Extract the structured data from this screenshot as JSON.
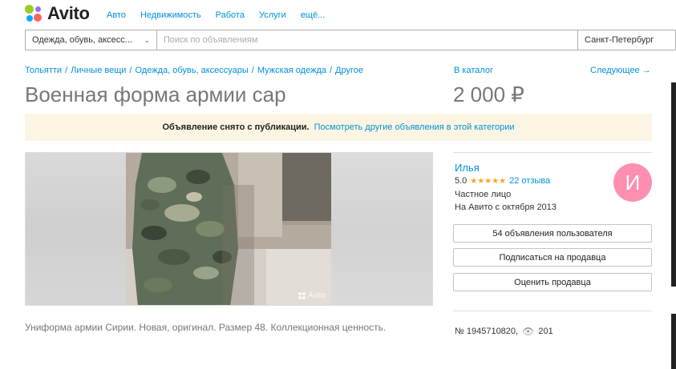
{
  "brand": {
    "name": "Avito"
  },
  "topnav": [
    "Авто",
    "Недвижимость",
    "Работа",
    "Услуги",
    "ещё..."
  ],
  "search": {
    "category": "Одежда, обувь, аксесс...",
    "placeholder": "Поиск по объявлениям",
    "city": "Санкт-Петербург"
  },
  "breadcrumbs": [
    "Тольятти",
    "Личные вещи",
    "Одежда, обувь, аксессуары",
    "Мужская одежда",
    "Другое"
  ],
  "catalog_link": "В каталог",
  "next_link": "Следующее →",
  "listing": {
    "title": "Военная форма армии сар",
    "price": "2 000 ₽",
    "description": "Униформа армии Сирии. Новая, оригинал. Размер 48. Коллекционная ценность.",
    "number": "№ 1945710820,",
    "views": "201",
    "watermark": "Avito"
  },
  "notice": {
    "bold": "Объявление снято с публикации.",
    "link": "Посмотреть другие объявления в этой категории"
  },
  "seller": {
    "name": "Илья",
    "rating": "5.0",
    "stars": "★★★★★",
    "reviews": "22 отзыва",
    "type": "Частное лицо",
    "since": "На Авито с октября 2013",
    "avatar_letter": "И",
    "avatar_color": "#ff8fb0"
  },
  "buttons": {
    "user_ads": "54 объявления пользователя",
    "subscribe": "Подписаться на продавца",
    "rate": "Оценить продавца"
  },
  "colors": {
    "link": "#0091d9",
    "notice_bg": "#fdf5e3",
    "star": "#f5a623"
  }
}
